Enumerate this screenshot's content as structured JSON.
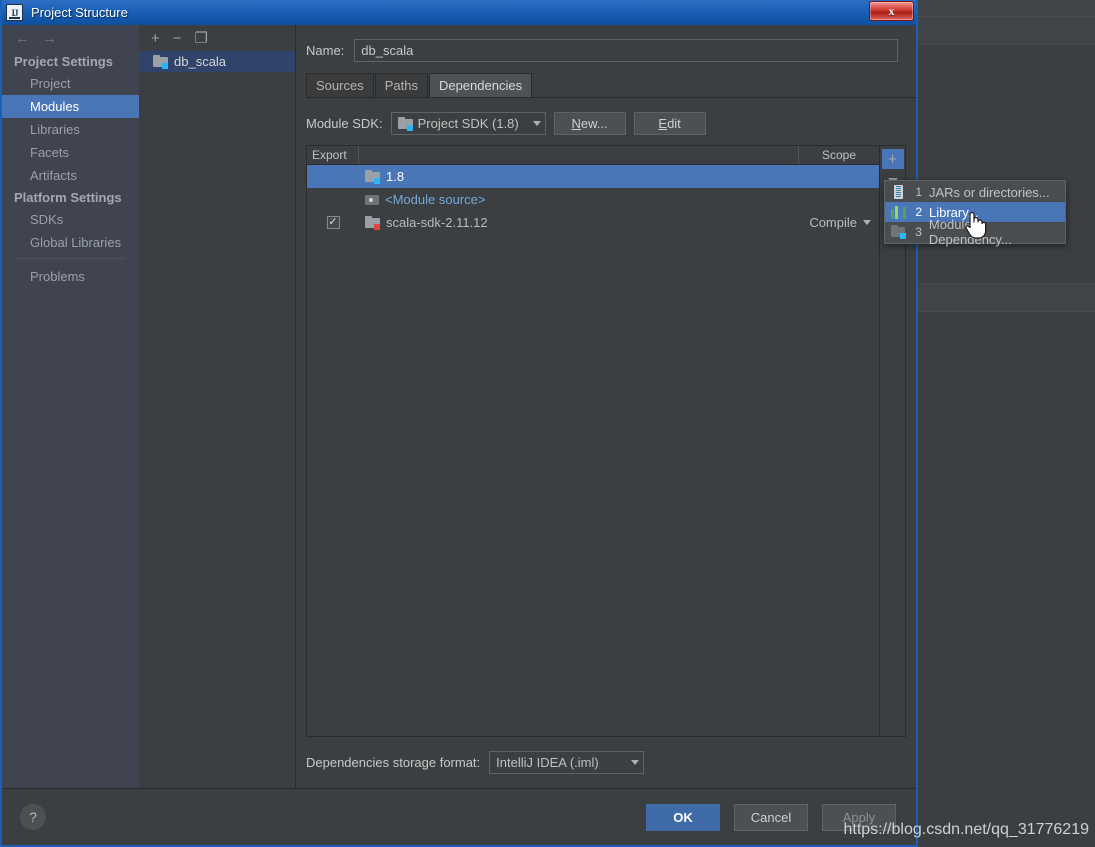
{
  "window": {
    "title": "Project Structure",
    "app_icon": "intellij-idea-icon",
    "close_label": "x"
  },
  "settings_nav": {
    "back_icon": "arrow-left-icon",
    "forward_icon": "arrow-right-icon",
    "groups": [
      {
        "title": "Project Settings",
        "items": [
          {
            "label": "Project",
            "selected": false
          },
          {
            "label": "Modules",
            "selected": true
          },
          {
            "label": "Libraries",
            "selected": false
          },
          {
            "label": "Facets",
            "selected": false
          },
          {
            "label": "Artifacts",
            "selected": false
          }
        ]
      },
      {
        "title": "Platform Settings",
        "items": [
          {
            "label": "SDKs",
            "selected": false
          },
          {
            "label": "Global Libraries",
            "selected": false
          }
        ]
      }
    ],
    "problems_label": "Problems"
  },
  "module_panel": {
    "toolbar": {
      "add_label": "+",
      "remove_label": "−",
      "copy_label": "❐"
    },
    "modules": [
      {
        "label": "db_scala",
        "icon": "module-folder-icon",
        "selected": true
      }
    ]
  },
  "main": {
    "name_label": "Name:",
    "name_value": "db_scala",
    "name_placeholder": "",
    "tabs": [
      {
        "label": "Sources",
        "active": false
      },
      {
        "label": "Paths",
        "active": false
      },
      {
        "label": "Dependencies",
        "active": true
      }
    ],
    "sdk_label": "Module SDK:",
    "sdk_value": "Project SDK (1.8)",
    "new_button": {
      "mnemonic": "N",
      "rest": "ew..."
    },
    "edit_button": {
      "mnemonic": "E",
      "rest": "dit"
    },
    "table": {
      "headers": {
        "export": "Export",
        "scope": "Scope"
      },
      "rows": [
        {
          "export_checked": null,
          "icon": "jdk-folder-icon",
          "name": "1.8",
          "scope": "",
          "selected": true,
          "name_style": "normal"
        },
        {
          "export_checked": null,
          "icon": "module-source-icon",
          "name": "<Module source>",
          "scope": "",
          "selected": false,
          "name_style": "link"
        },
        {
          "export_checked": true,
          "icon": "library-folder-icon",
          "name": "scala-sdk-2.11.12",
          "scope": "Compile",
          "selected": false,
          "name_style": "normal"
        }
      ]
    },
    "side_toolbar": [
      {
        "name": "add-dependency-button",
        "glyph": "+",
        "active": true
      },
      {
        "name": "more-dropdown-button",
        "glyph": "caret-down",
        "active": false
      },
      {
        "name": "edit-dependency-button",
        "glyph": "pencil",
        "active": false
      }
    ],
    "storage_label": "Dependencies storage format:",
    "storage_value": "IntelliJ IDEA (.iml)"
  },
  "add_popup": {
    "items": [
      {
        "number": "1",
        "label": "JARs or directories...",
        "icon": "jar-icon",
        "selected": false
      },
      {
        "number": "2",
        "label": "Library...",
        "icon": "library-icon",
        "selected": true
      },
      {
        "number": "3",
        "label": "Module Dependency...",
        "icon": "module-dependency-icon",
        "selected": false
      }
    ]
  },
  "footer": {
    "help_label": "?",
    "ok_label": "OK",
    "cancel_label": "Cancel",
    "apply_label": "Apply"
  },
  "watermark": {
    "text": "https://blog.csdn.net/qq_31776219"
  },
  "colors": {
    "accent_selection": "#4a76b8",
    "title_bar": "#1a5fb8",
    "panel_bg": "#3c3f41",
    "nav_bg": "#3f4450",
    "link_text": "#78a8d8",
    "close_button": "#ab1f18"
  }
}
